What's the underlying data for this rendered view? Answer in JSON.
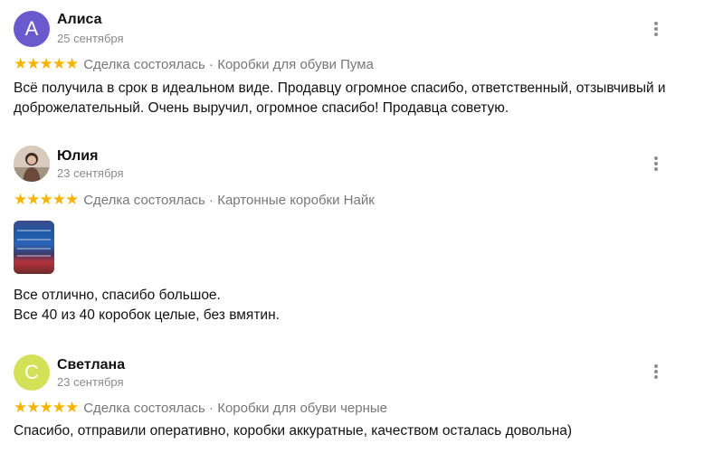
{
  "reviews": [
    {
      "name": "Алиса",
      "date": "25 сентября",
      "avatar_letter": "А",
      "avatar_color": "#6a5acd",
      "stars": "★★★★★",
      "meta": "Сделка состоялась · Коробки для обуви Пума",
      "text": [
        "Всё получила в срок в идеальном виде. Продавцу огромное спасибо, ответственный, отзывчивый и",
        "доброжелательный. Очень выручил, огромное спасибо! Продавца советую."
      ]
    },
    {
      "name": "Юлия",
      "date": "23 сентября",
      "avatar_letter": "",
      "avatar_color": "#c9b8a6",
      "stars": "★★★★★",
      "meta": "Сделка состоялась · Картонные коробки Найк",
      "text": [
        "Все отлично, спасибо большое.",
        "Все 40 из 40 коробок целые, без вмятин."
      ]
    },
    {
      "name": "Светлана",
      "date": "23 сентября",
      "avatar_letter": "С",
      "avatar_color": "#d4e157",
      "stars": "★★★★★",
      "meta": "Сделка состоялась · Коробки для обуви черные",
      "text": [
        "Спасибо, отправили оперативно, коробки аккуратные, качеством осталась довольна)"
      ]
    }
  ],
  "accent": {
    "star_color": "#f5b400"
  },
  "icons": {
    "menu": "more-vertical-icon",
    "star": "star-icon"
  }
}
